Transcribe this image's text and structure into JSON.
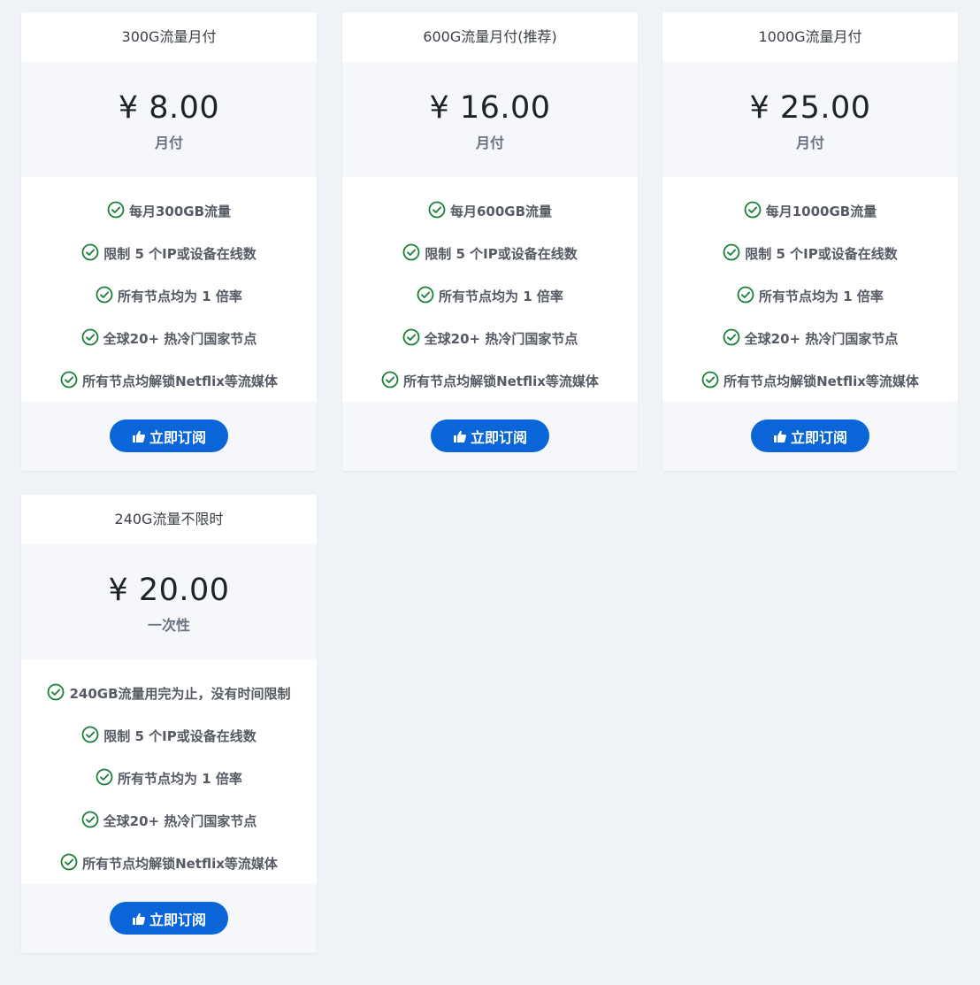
{
  "colors": {
    "page_bg": "#eff2f7",
    "card_bg": "#ffffff",
    "price_bg": "#f5f7fb",
    "accent": "#0a66d8",
    "check": "#1a7f37"
  },
  "plans": [
    {
      "title": "300G流量月付",
      "price": "¥ 8.00",
      "period": "月付",
      "features": [
        "每月300GB流量",
        "限制 5 个IP或设备在线数",
        "所有节点均为 1 倍率",
        "全球20+ 热冷门国家节点",
        "所有节点均解锁Netflix等流媒体"
      ],
      "button": "立即订阅",
      "button_icon": "thumbs-up-icon",
      "feature_icon": "check-circle-icon"
    },
    {
      "title": "600G流量月付(推荐)",
      "price": "¥ 16.00",
      "period": "月付",
      "features": [
        "每月600GB流量",
        "限制 5 个IP或设备在线数",
        "所有节点均为 1 倍率",
        "全球20+ 热冷门国家节点",
        "所有节点均解锁Netflix等流媒体"
      ],
      "button": "立即订阅",
      "button_icon": "thumbs-up-icon",
      "feature_icon": "check-circle-icon"
    },
    {
      "title": "1000G流量月付",
      "price": "¥ 25.00",
      "period": "月付",
      "features": [
        "每月1000GB流量",
        "限制 5 个IP或设备在线数",
        "所有节点均为 1 倍率",
        "全球20+ 热冷门国家节点",
        "所有节点均解锁Netflix等流媒体"
      ],
      "button": "立即订阅",
      "button_icon": "thumbs-up-icon",
      "feature_icon": "check-circle-icon"
    },
    {
      "title": "240G流量不限时",
      "price": "¥ 20.00",
      "period": "一次性",
      "features": [
        "240GB流量用完为止，没有时间限制",
        "限制 5 个IP或设备在线数",
        "所有节点均为 1 倍率",
        "全球20+ 热冷门国家节点",
        "所有节点均解锁Netflix等流媒体"
      ],
      "button": "立即订阅",
      "button_icon": "thumbs-up-icon",
      "feature_icon": "check-circle-icon"
    }
  ]
}
